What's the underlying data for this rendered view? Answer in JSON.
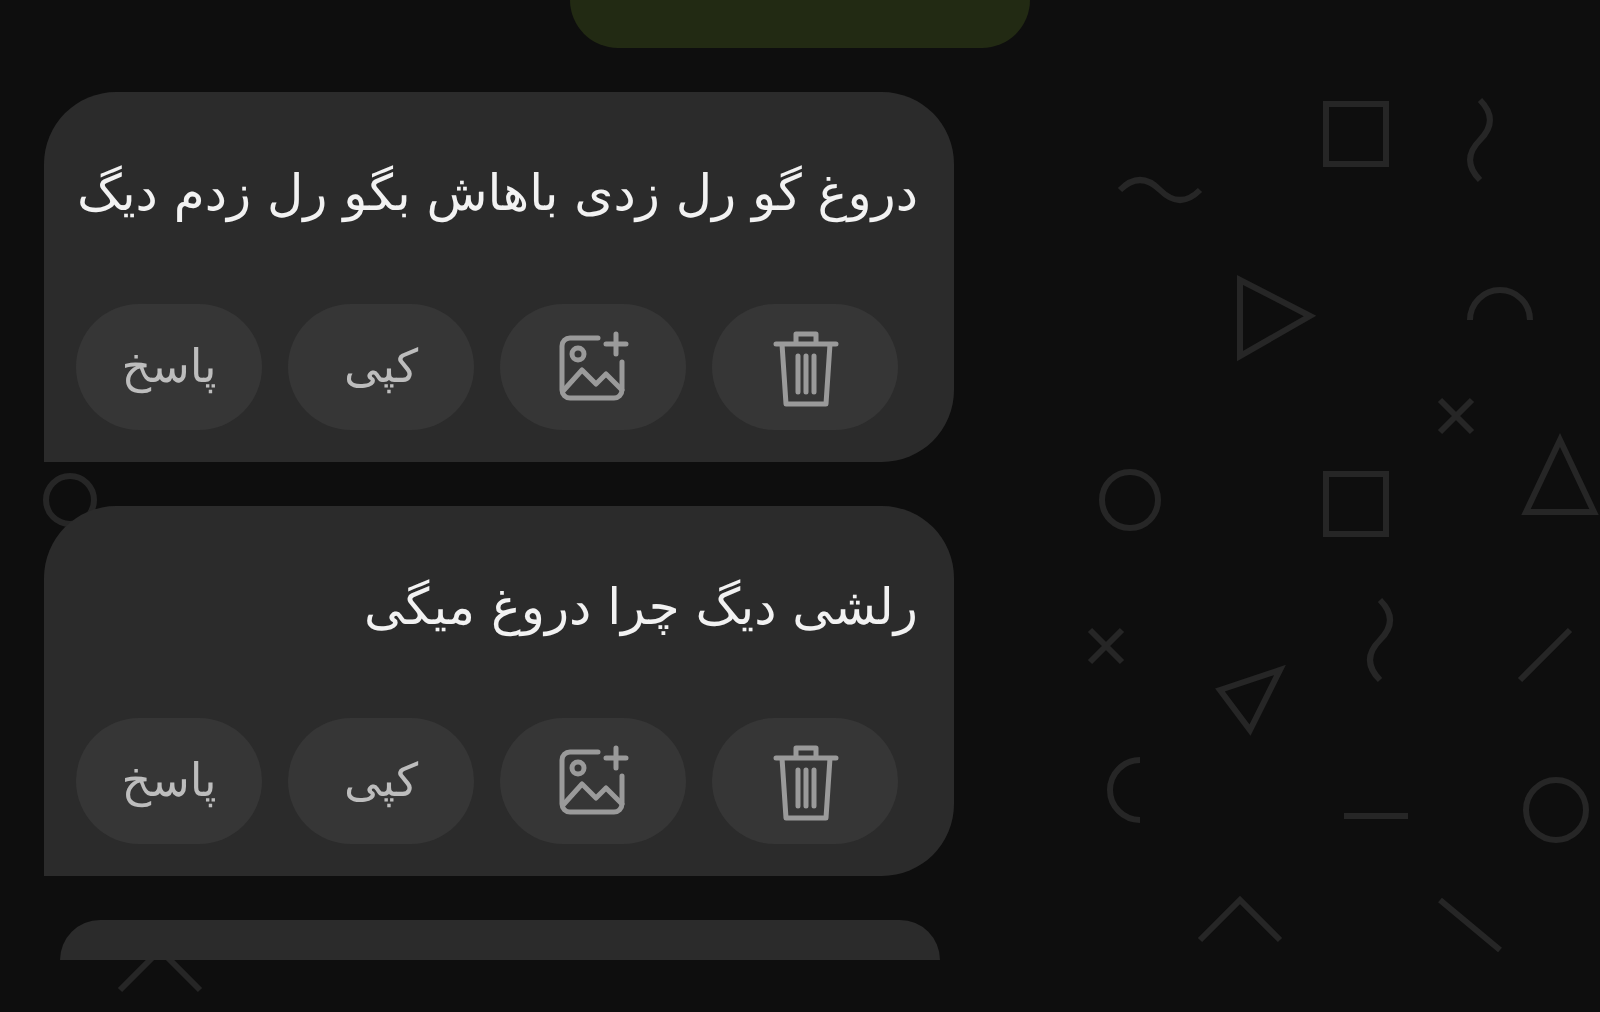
{
  "messages": [
    {
      "text": "دروغ گو رل زدی باهاش بگو رل زدم دیگ",
      "actions": [
        {
          "kind": "delete"
        },
        {
          "kind": "image"
        },
        {
          "kind": "copy",
          "label": "کپی"
        },
        {
          "kind": "reply",
          "label": "پاسخ"
        }
      ]
    },
    {
      "text": "رلشی دیگ چرا دروغ میگی",
      "actions": [
        {
          "kind": "delete"
        },
        {
          "kind": "image"
        },
        {
          "kind": "copy",
          "label": "کپی"
        },
        {
          "kind": "reply",
          "label": "پاسخ"
        }
      ]
    }
  ]
}
